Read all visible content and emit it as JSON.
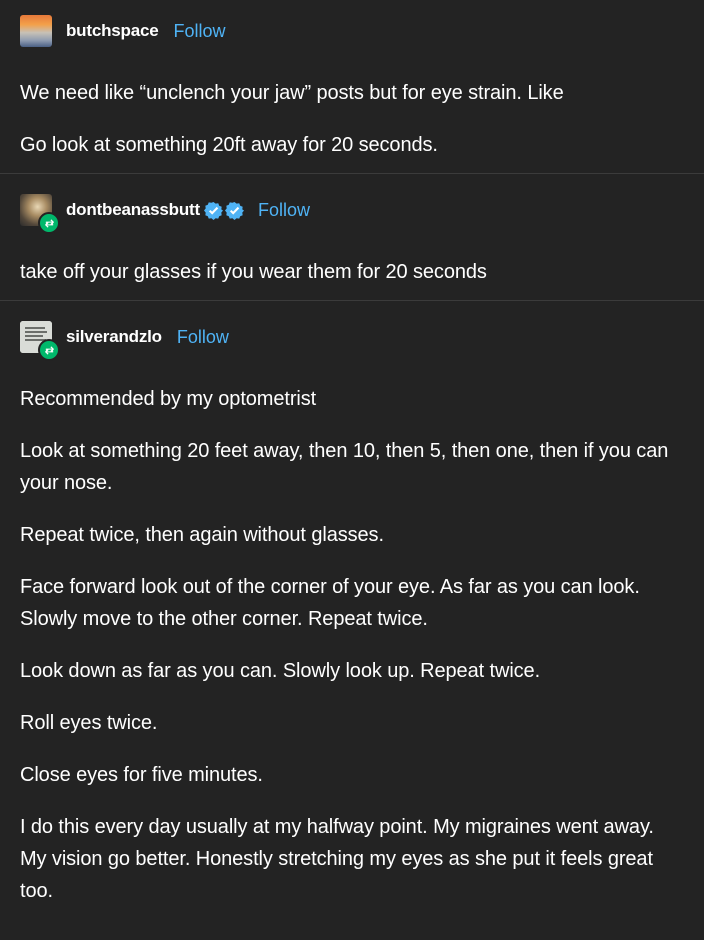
{
  "posts": [
    {
      "username": "butchspace",
      "follow": "Follow",
      "avatar_icon": "butchspace-avatar",
      "paragraphs": [
        "We need like “unclench your jaw” posts but for eye strain. Like",
        "Go look at something 20ft away for 20 seconds."
      ]
    },
    {
      "username": "dontbeanassbutt",
      "follow": "Follow",
      "avatar_icon": "dontbeanassbutt-avatar",
      "badges": [
        "verified-badge-icon",
        "verified-badge-icon"
      ],
      "badge_color": "#4fb3f5",
      "paragraphs": [
        "take off your glasses if you wear them for 20 seconds"
      ]
    },
    {
      "username": "silverandzlo",
      "follow": "Follow",
      "avatar_icon": "silverandzlo-avatar",
      "paragraphs": [
        "Recommended by my optometrist",
        "Look at something 20 feet away, then 10, then 5, then one, then if you can your nose.",
        "Repeat twice, then again without glasses.",
        "Face forward look out of the corner of your eye. As far as you can look. Slowly move to the other corner. Repeat twice.",
        "Look down as far as you can. Slowly look up. Repeat twice.",
        "Roll eyes twice.",
        "Close eyes for five minutes.",
        "I do this every day usually at my halfway point. My migraines went away. My vision go better. Honestly stretching my eyes as she put it feels great too."
      ]
    }
  ],
  "colors": {
    "background": "#232323",
    "follow": "#4fb3f5",
    "reblog": "#00b86b"
  }
}
